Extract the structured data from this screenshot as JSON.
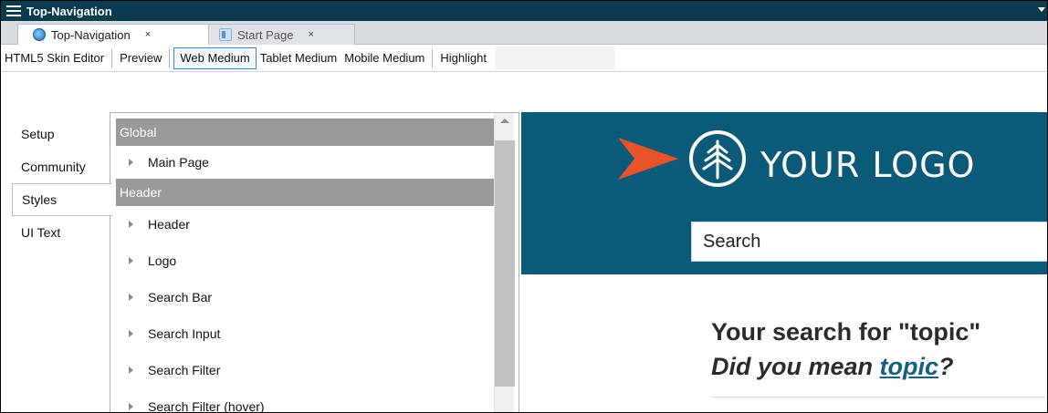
{
  "window": {
    "title": "Top-Navigation"
  },
  "tabs": [
    {
      "label": "Top-Navigation",
      "close": "×",
      "active": true
    },
    {
      "label": "Start Page",
      "close": "×",
      "active": false
    }
  ],
  "toolbar": {
    "items": [
      "HTML5 Skin Editor",
      "Preview",
      "Web Medium",
      "Tablet Medium",
      "Mobile Medium",
      "Highlight"
    ],
    "selected": "Web Medium"
  },
  "side_tabs": [
    "Setup",
    "Community",
    "Styles",
    "UI Text"
  ],
  "side_tab_active": "Styles",
  "style_tree": {
    "groups": [
      {
        "name": "Global",
        "items": [
          "Main Page"
        ]
      },
      {
        "name": "Header",
        "items": [
          "Header",
          "Logo",
          "Search Bar",
          "Search Input",
          "Search Filter",
          "Search Filter (hover)"
        ]
      }
    ]
  },
  "preview": {
    "logo_text": "YOUR LOGO",
    "search_placeholder": "Search",
    "results_heading": "Your search for \"topic\"",
    "did_you_mean_prefix": "Did you mean ",
    "did_you_mean_link": "topic",
    "did_you_mean_suffix": "?",
    "colors": {
      "hero": "#0a5a78",
      "accent_arrow": "#e8532a",
      "link": "#16607d"
    }
  }
}
